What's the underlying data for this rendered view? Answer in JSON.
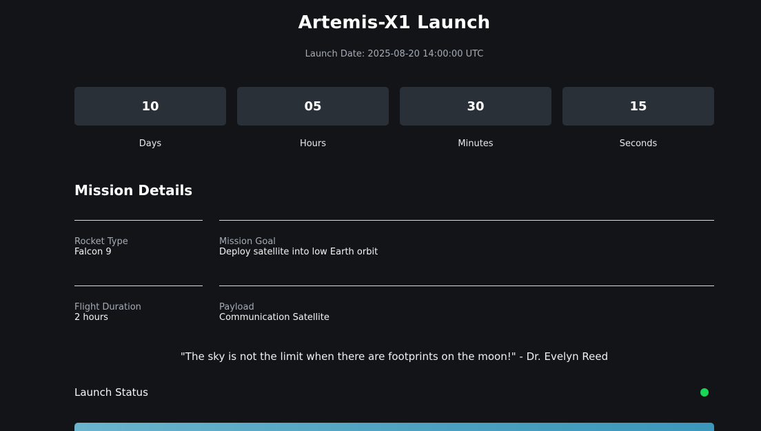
{
  "header": {
    "title": "Artemis-X1 Launch",
    "launch_date": "Launch Date: 2025-08-20 14:00:00 UTC"
  },
  "countdown": [
    {
      "value": "10",
      "label": "Days"
    },
    {
      "value": "05",
      "label": "Hours"
    },
    {
      "value": "30",
      "label": "Minutes"
    },
    {
      "value": "15",
      "label": "Seconds"
    }
  ],
  "mission": {
    "title": "Mission Details",
    "rocket_type": {
      "label": "Rocket Type",
      "value": "Falcon 9"
    },
    "mission_goal": {
      "label": "Mission Goal",
      "value": "Deploy satellite into low Earth orbit"
    },
    "flight_duration": {
      "label": "Flight Duration",
      "value": "2 hours"
    },
    "payload": {
      "label": "Payload",
      "value": "Communication Satellite"
    }
  },
  "quote": "\"The sky is not the limit when there are footprints on the moon!\" - Dr. Evelyn Reed",
  "status": {
    "label": "Launch Status",
    "indicator_color": "#18d656",
    "bar_colors": [
      "#6bb4cc",
      "#3b97bb"
    ]
  }
}
